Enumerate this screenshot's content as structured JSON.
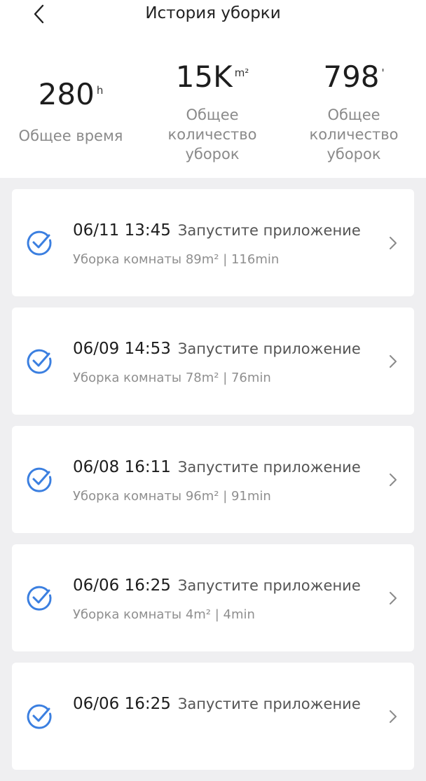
{
  "header": {
    "title": "История уборки"
  },
  "stats": [
    {
      "value": "280",
      "unit": "h",
      "label": "Общее время"
    },
    {
      "value": "15K",
      "unit": "m²",
      "label": "Общее количество уборок"
    },
    {
      "value": "798",
      "unit": "'",
      "label": "Общее количество уборок"
    }
  ],
  "records": [
    {
      "date": "06/11 13:45",
      "status": "Запустите приложение",
      "details": "Уборка комнаты 89m² | 116min"
    },
    {
      "date": "06/09 14:53",
      "status": "Запустите приложение",
      "details": "Уборка комнаты 78m² | 76min"
    },
    {
      "date": "06/08 16:11",
      "status": "Запустите приложение",
      "details": "Уборка комнаты 96m² | 91min"
    },
    {
      "date": "06/06 16:25",
      "status": "Запустите приложение",
      "details": "Уборка комнаты 4m² | 4min"
    },
    {
      "date": "06/06 16:25",
      "status": "Запустите приложение",
      "details": ""
    }
  ],
  "colors": {
    "accent": "#3b7fe0",
    "background": "#efeff1"
  },
  "icons": {
    "back": "chevron-left-icon",
    "record_status": "check-circle-icon",
    "record_open": "chevron-right-icon"
  }
}
